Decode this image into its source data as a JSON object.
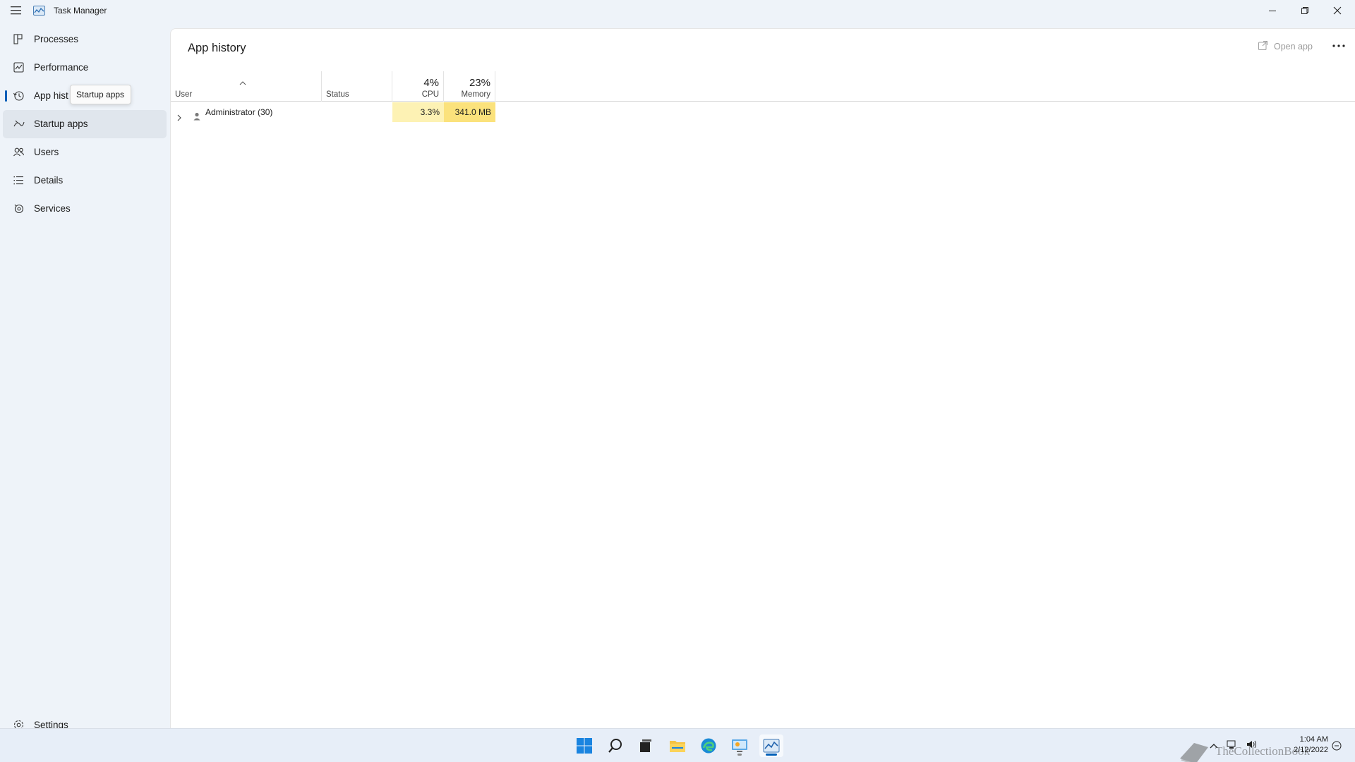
{
  "window": {
    "title": "Task Manager",
    "controls": [
      "minimize",
      "restore",
      "close"
    ]
  },
  "sidebar": {
    "items": [
      {
        "label": "Processes",
        "icon": "processes-icon"
      },
      {
        "label": "Performance",
        "icon": "performance-icon"
      },
      {
        "label": "App hist",
        "icon": "history-icon",
        "active": true
      },
      {
        "label": "Startup apps",
        "icon": "startup-icon",
        "hovered": true
      },
      {
        "label": "Users",
        "icon": "users-icon"
      },
      {
        "label": "Details",
        "icon": "details-icon"
      },
      {
        "label": "Services",
        "icon": "services-icon"
      }
    ],
    "settings_label": "Settings",
    "tooltip": "Startup apps"
  },
  "main": {
    "title": "App history",
    "open_app_label": "Open app",
    "more_label": "..."
  },
  "table": {
    "columns": {
      "user": "User",
      "status": "Status",
      "cpu": {
        "label": "CPU",
        "percent": "4%"
      },
      "memory": {
        "label": "Memory",
        "percent": "23%"
      }
    },
    "rows": [
      {
        "user": "Administrator (30)",
        "status": "",
        "cpu": "3.3%",
        "memory": "341.0 MB"
      }
    ]
  },
  "taskbar": {
    "apps": [
      "start-icon",
      "search-icon",
      "task-view-icon",
      "file-explorer-icon",
      "edge-icon",
      "control-panel-icon",
      "task-manager-icon"
    ],
    "clock_time": "1:04 AM",
    "clock_date": "2/12/2022",
    "watermark": "TheCollectionBook"
  },
  "colors": {
    "accent": "#005fb8",
    "heat_light": "#fdf2b4",
    "heat_medium": "#fbe27c",
    "sidebar_bg": "#eef3f9",
    "main_bg": "#ffffff"
  }
}
